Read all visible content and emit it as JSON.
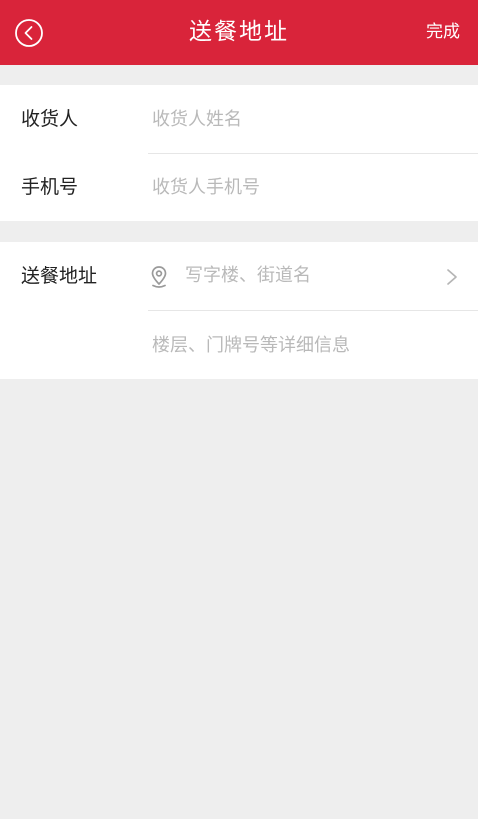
{
  "header": {
    "title": "送餐地址",
    "done_label": "完成",
    "back_icon": "back-circle-icon",
    "background_color": "#d9243a"
  },
  "form": {
    "receiver": {
      "label": "收货人",
      "placeholder": "收货人姓名",
      "value": ""
    },
    "phone": {
      "label": "手机号",
      "placeholder": "收货人手机号",
      "value": ""
    },
    "address": {
      "label": "送餐地址",
      "location_placeholder": "写字楼、街道名",
      "location_icon": "location-pin-icon",
      "arrow_icon": "chevron-right-icon",
      "detail_placeholder": "楼层、门牌号等详细信息",
      "detail_value": ""
    }
  }
}
